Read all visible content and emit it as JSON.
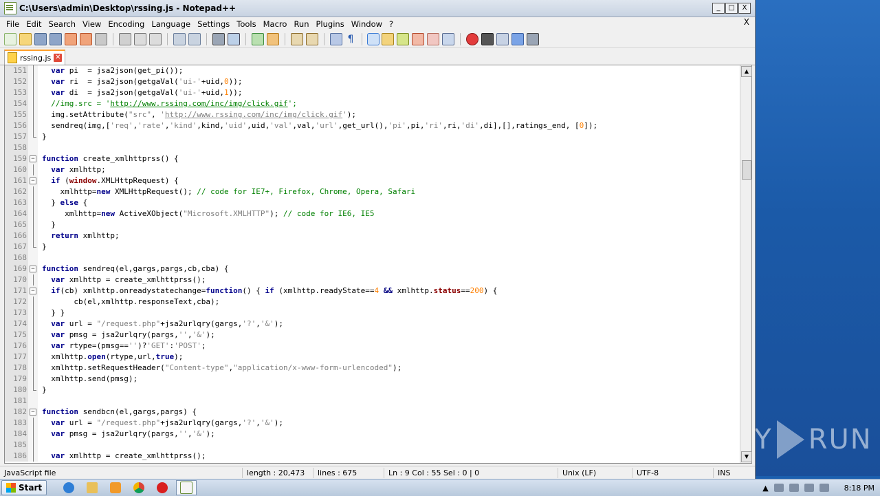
{
  "window": {
    "title": "C:\\Users\\admin\\Desktop\\rssing.js - Notepad++",
    "buttons": {
      "minimize": "_",
      "maximize": "□",
      "close": "X"
    }
  },
  "menubar": {
    "items": [
      "File",
      "Edit",
      "Search",
      "View",
      "Encoding",
      "Language",
      "Settings",
      "Tools",
      "Macro",
      "Run",
      "Plugins",
      "Window",
      "?"
    ],
    "close_x": "X"
  },
  "toolbar": {
    "icons": [
      "new-icon",
      "open-icon",
      "save-icon",
      "save-all-icon",
      "close-icon",
      "close-all-icon",
      "print-icon",
      "cut-icon",
      "copy-icon",
      "paste-icon",
      "undo-icon",
      "redo-icon",
      "find-icon",
      "replace-icon",
      "zoom-in-icon",
      "zoom-out-icon",
      "sync-v-icon",
      "sync-h-icon",
      "word-wrap-icon",
      "show-all-chars-icon",
      "indent-guide-icon",
      "udl-icon",
      "doc-map-icon",
      "function-list-icon",
      "folder-workspace-icon",
      "monitor-icon",
      "record-macro-icon",
      "stop-macro-icon",
      "play-macro-icon",
      "run-macro-multiple-icon",
      "save-macro-icon"
    ]
  },
  "tab": {
    "label": "rssing.js"
  },
  "editor": {
    "lines": [
      {
        "n": "151",
        "fold": "bar",
        "html": "  <span class='kw'>var</span> pi  = jsa2json(get_pi());"
      },
      {
        "n": "152",
        "fold": "bar",
        "html": "  <span class='kw'>var</span> ri  = jsa2json(getgaVal(<span class='str'>'ui-'</span>+uid,<span class='num'>0</span>));"
      },
      {
        "n": "153",
        "fold": "bar",
        "html": "  <span class='kw'>var</span> di  = jsa2json(getgaVal(<span class='str'>'ui-'</span>+uid,<span class='num'>1</span>));"
      },
      {
        "n": "154",
        "fold": "bar",
        "html": "  <span class='cmt'>//img.src = '<span class='url'>http://www.rssing.com/inc/img/click.gif</span>';</span>"
      },
      {
        "n": "155",
        "fold": "bar",
        "html": "  img.setAttribute(<span class='str'>\"src\"</span>, <span class='str'>'<u>http://www.rssing.com/inc/img/click.gif</u>'</span>);"
      },
      {
        "n": "156",
        "fold": "bar",
        "html": "  sendreq(img,[<span class='str'>'req'</span>,<span class='str'>'rate'</span>,<span class='str'>'kind'</span>,kind,<span class='str'>'uid'</span>,uid,<span class='str'>'val'</span>,val,<span class='str'>'url'</span>,get_url(),<span class='str'>'pi'</span>,pi,<span class='str'>'ri'</span>,ri,<span class='str'>'di'</span>,di],[],ratings_end, [<span class='num'>0</span>]);"
      },
      {
        "n": "157",
        "fold": "end",
        "html": "}"
      },
      {
        "n": "158",
        "fold": "",
        "html": ""
      },
      {
        "n": "159",
        "fold": "box",
        "html": "<span class='kw'>function</span> create_xmlhttprss() {"
      },
      {
        "n": "160",
        "fold": "bar",
        "html": "  <span class='kw'>var</span> xmlhttp;"
      },
      {
        "n": "161",
        "fold": "box",
        "html": "  <span class='kw'>if</span> (<span style='color:#8b0000;font-weight:bold'>window</span>.XMLHttpRequest) {"
      },
      {
        "n": "162",
        "fold": "bar",
        "html": "    xmlhttp=<span class='kw'>new</span> XMLHttpRequest(); <span class='cmt'>// code for IE7+, Firefox, Chrome, Opera, Safari</span>"
      },
      {
        "n": "163",
        "fold": "bar",
        "html": "  } <span class='kw'>else</span> {"
      },
      {
        "n": "164",
        "fold": "bar",
        "html": "     xmlhttp=<span class='kw'>new</span> ActiveXObject(<span class='str'>\"Microsoft.XMLHTTP\"</span>); <span class='cmt'>// code for IE6, IE5</span>"
      },
      {
        "n": "165",
        "fold": "bar",
        "html": "  }"
      },
      {
        "n": "166",
        "fold": "bar",
        "html": "  <span class='kw'>return</span> xmlhttp;"
      },
      {
        "n": "167",
        "fold": "end",
        "html": "}"
      },
      {
        "n": "168",
        "fold": "",
        "html": ""
      },
      {
        "n": "169",
        "fold": "box",
        "html": "<span class='kw'>function</span> sendreq(el,gargs,pargs,cb,cba) {"
      },
      {
        "n": "170",
        "fold": "bar",
        "html": "  <span class='kw'>var</span> xmlhttp = create_xmlhttprss();"
      },
      {
        "n": "171",
        "fold": "box",
        "html": "  <span class='kw'>if</span>(cb) xmlhttp.onreadystatechange=<span class='kw'>function</span>() { <span class='kw'>if</span> (xmlhttp.readyState==<span class='num'>4</span> <span class='op'>&amp;&amp;</span> xmlhttp.<span style='color:#8b0000;font-weight:bold'>status</span>==<span class='num'>200</span>) {"
      },
      {
        "n": "172",
        "fold": "bar",
        "html": "       cb(el,xmlhttp.responseText,cba);"
      },
      {
        "n": "173",
        "fold": "bar",
        "html": "  } }"
      },
      {
        "n": "174",
        "fold": "bar",
        "html": "  <span class='kw'>var</span> url = <span class='str'>\"/request.php\"</span>+jsa2urlqry(gargs,<span class='str'>'?'</span>,<span class='str'>'&amp;'</span>);"
      },
      {
        "n": "175",
        "fold": "bar",
        "html": "  <span class='kw'>var</span> pmsg = jsa2urlqry(pargs,<span class='str'>''</span>,<span class='str'>'&amp;'</span>);"
      },
      {
        "n": "176",
        "fold": "bar",
        "html": "  <span class='kw'>var</span> rtype=(pmsg==<span class='str'>''</span>)?<span class='str'>'GET'</span>:<span class='str'>'POST'</span>;"
      },
      {
        "n": "177",
        "fold": "bar",
        "html": "  xmlhttp.<span class='kw'>open</span>(rtype,url,<span class='kw'>true</span>);"
      },
      {
        "n": "178",
        "fold": "bar",
        "html": "  xmlhttp.setRequestHeader(<span class='str'>\"Content-type\"</span>,<span class='str'>\"application/x-www-form-urlencoded\"</span>);"
      },
      {
        "n": "179",
        "fold": "bar",
        "html": "  xmlhttp.send(pmsg);"
      },
      {
        "n": "180",
        "fold": "end",
        "html": "}"
      },
      {
        "n": "181",
        "fold": "",
        "html": ""
      },
      {
        "n": "182",
        "fold": "box",
        "html": "<span class='kw'>function</span> sendbcn(el,gargs,pargs) {"
      },
      {
        "n": "183",
        "fold": "bar",
        "html": "  <span class='kw'>var</span> url = <span class='str'>\"/request.php\"</span>+jsa2urlqry(gargs,<span class='str'>'?'</span>,<span class='str'>'&amp;'</span>);"
      },
      {
        "n": "184",
        "fold": "bar",
        "html": "  <span class='kw'>var</span> pmsg = jsa2urlqry(pargs,<span class='str'>''</span>,<span class='str'>'&amp;'</span>);"
      },
      {
        "n": "185",
        "fold": "bar",
        "html": ""
      },
      {
        "n": "186",
        "fold": "bar",
        "html": "  <span class='kw'>var</span> xmlhttp = create_xmlhttprss();"
      }
    ]
  },
  "statusbar": {
    "language": "JavaScript file",
    "length": "length : 20,473",
    "lines": "lines : 675",
    "position": "Ln : 9    Col : 55    Sel : 0 | 0",
    "eol": "Unix (LF)",
    "encoding": "UTF-8",
    "mode": "INS"
  },
  "taskbar": {
    "start_label": "Start",
    "clock": "8:18 PM"
  },
  "watermark": {
    "text_left": "ANY",
    "text_right": "RUN"
  }
}
